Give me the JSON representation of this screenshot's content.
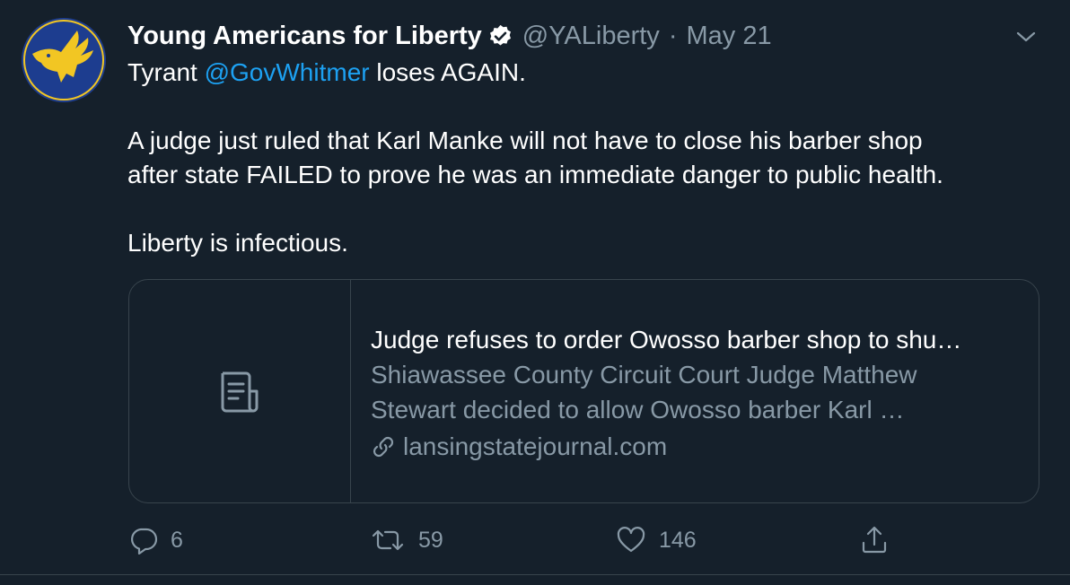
{
  "tweet": {
    "author_name": "Young Americans for Liberty",
    "handle": "@YALiberty",
    "separator": "·",
    "date": "May 21",
    "verified_icon": "verified-badge-icon",
    "text": {
      "line1_prefix": "Tyrant ",
      "mention": "@GovWhitmer",
      "line1_suffix": " loses AGAIN.",
      "line2": "A judge just ruled that Karl Manke will not have to close his barber shop",
      "line3": "after state FAILED to prove he was an immediate danger to public health.",
      "line4": "Liberty is infectious."
    },
    "card": {
      "title": "Judge refuses to order Owosso barber shop to shu…",
      "desc_line1": "Shiawassee County Circuit Court Judge Matthew",
      "desc_line2": "Stewart decided to allow Owosso barber Karl …",
      "domain": "lansingstatejournal.com",
      "thumb_icon": "article-icon",
      "link_icon": "link-icon"
    },
    "actions": {
      "replies": "6",
      "retweets": "59",
      "likes": "146"
    }
  },
  "colors": {
    "background": "#15202b",
    "text": "#ffffff",
    "secondary": "#8899a6",
    "link": "#1da1f2",
    "border": "#38444d",
    "avatar_bg": "#1d3d8f",
    "avatar_eagle": "#f2c623"
  }
}
